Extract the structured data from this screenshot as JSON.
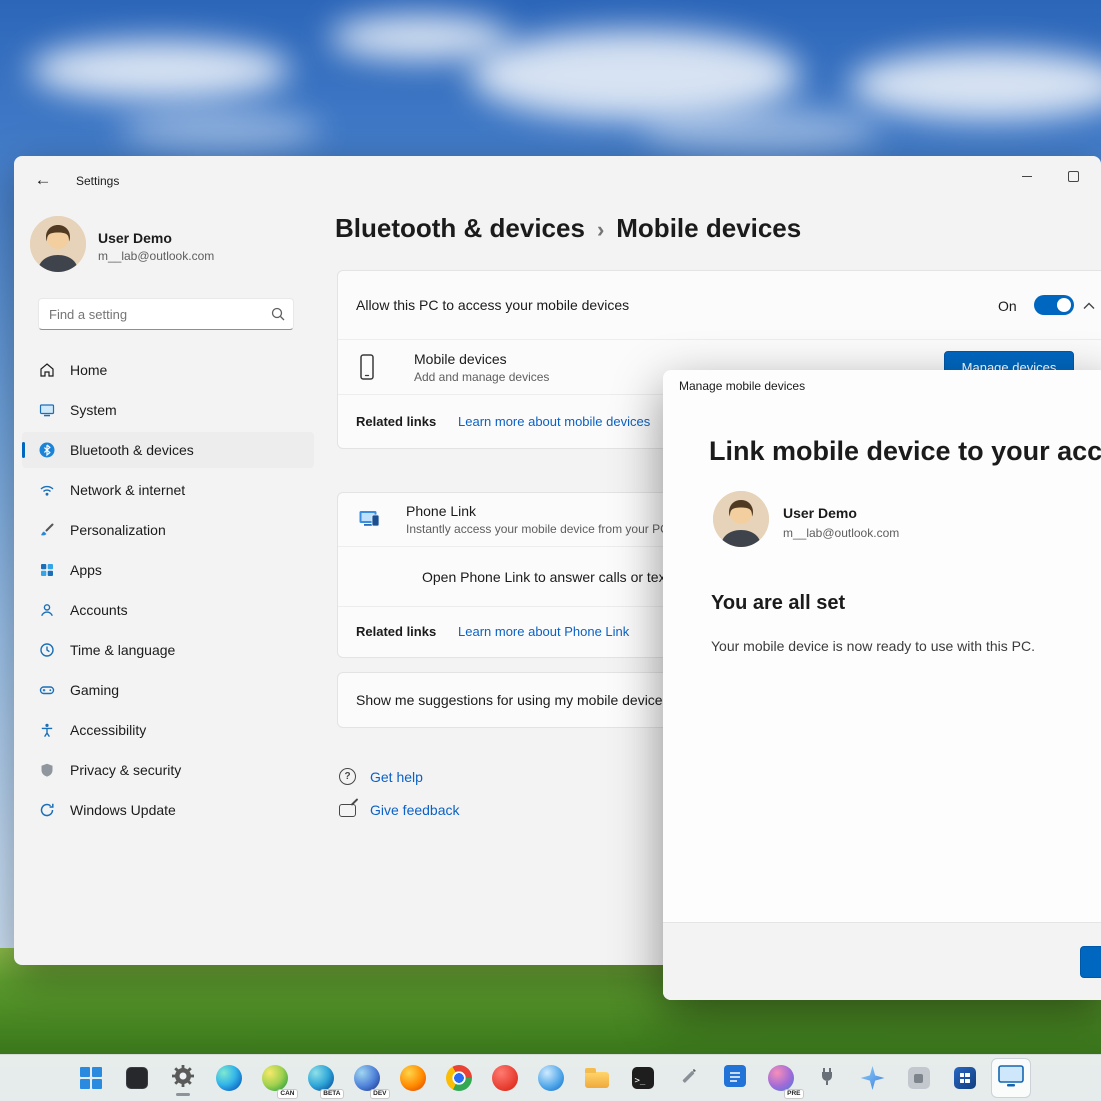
{
  "colors": {
    "accent": "#0067c0",
    "link": "#0b62c4"
  },
  "titlebar": {
    "app_title": "Settings"
  },
  "user": {
    "name": "User Demo",
    "email": "m__lab@outlook.com"
  },
  "sidebar": {
    "search_placeholder": "Find a setting",
    "items": [
      {
        "label": "Home"
      },
      {
        "label": "System"
      },
      {
        "label": "Bluetooth & devices"
      },
      {
        "label": "Network & internet"
      },
      {
        "label": "Personalization"
      },
      {
        "label": "Apps"
      },
      {
        "label": "Accounts"
      },
      {
        "label": "Time & language"
      },
      {
        "label": "Gaming"
      },
      {
        "label": "Accessibility"
      },
      {
        "label": "Privacy & security"
      },
      {
        "label": "Windows Update"
      }
    ]
  },
  "breadcrumb": {
    "parent": "Bluetooth & devices",
    "separator": "›",
    "current": "Mobile devices"
  },
  "allow_card": {
    "label": "Allow this PC to access your mobile devices",
    "toggle_state": "On"
  },
  "mobile_devices": {
    "title": "Mobile devices",
    "subtitle": "Add and manage devices",
    "manage_button": "Manage devices"
  },
  "related_mobile": {
    "label": "Related links",
    "link": "Learn more about mobile devices"
  },
  "phone_link": {
    "title": "Phone Link",
    "subtitle": "Instantly access your mobile device from your PC",
    "open_row": "Open Phone Link to answer calls or texts, vi"
  },
  "related_phone": {
    "label": "Related links",
    "link": "Learn more about Phone Link"
  },
  "suggestions": {
    "label": "Show me suggestions for using my mobile device"
  },
  "help": {
    "get_help": "Get help",
    "give_feedback": "Give feedback"
  },
  "dialog": {
    "title": "Manage mobile devices",
    "heading": "Link mobile device to your account",
    "user_name": "User Demo",
    "user_email": "m__lab@outlook.com",
    "status_heading": "You are all set",
    "status_text": "Your mobile device is now ready to use with this PC."
  },
  "taskbar": {
    "terminal_glyph": ">_",
    "badges": {
      "canary": "CAN",
      "beta": "BETA",
      "dev": "DEV",
      "preview": "PRE"
    }
  }
}
